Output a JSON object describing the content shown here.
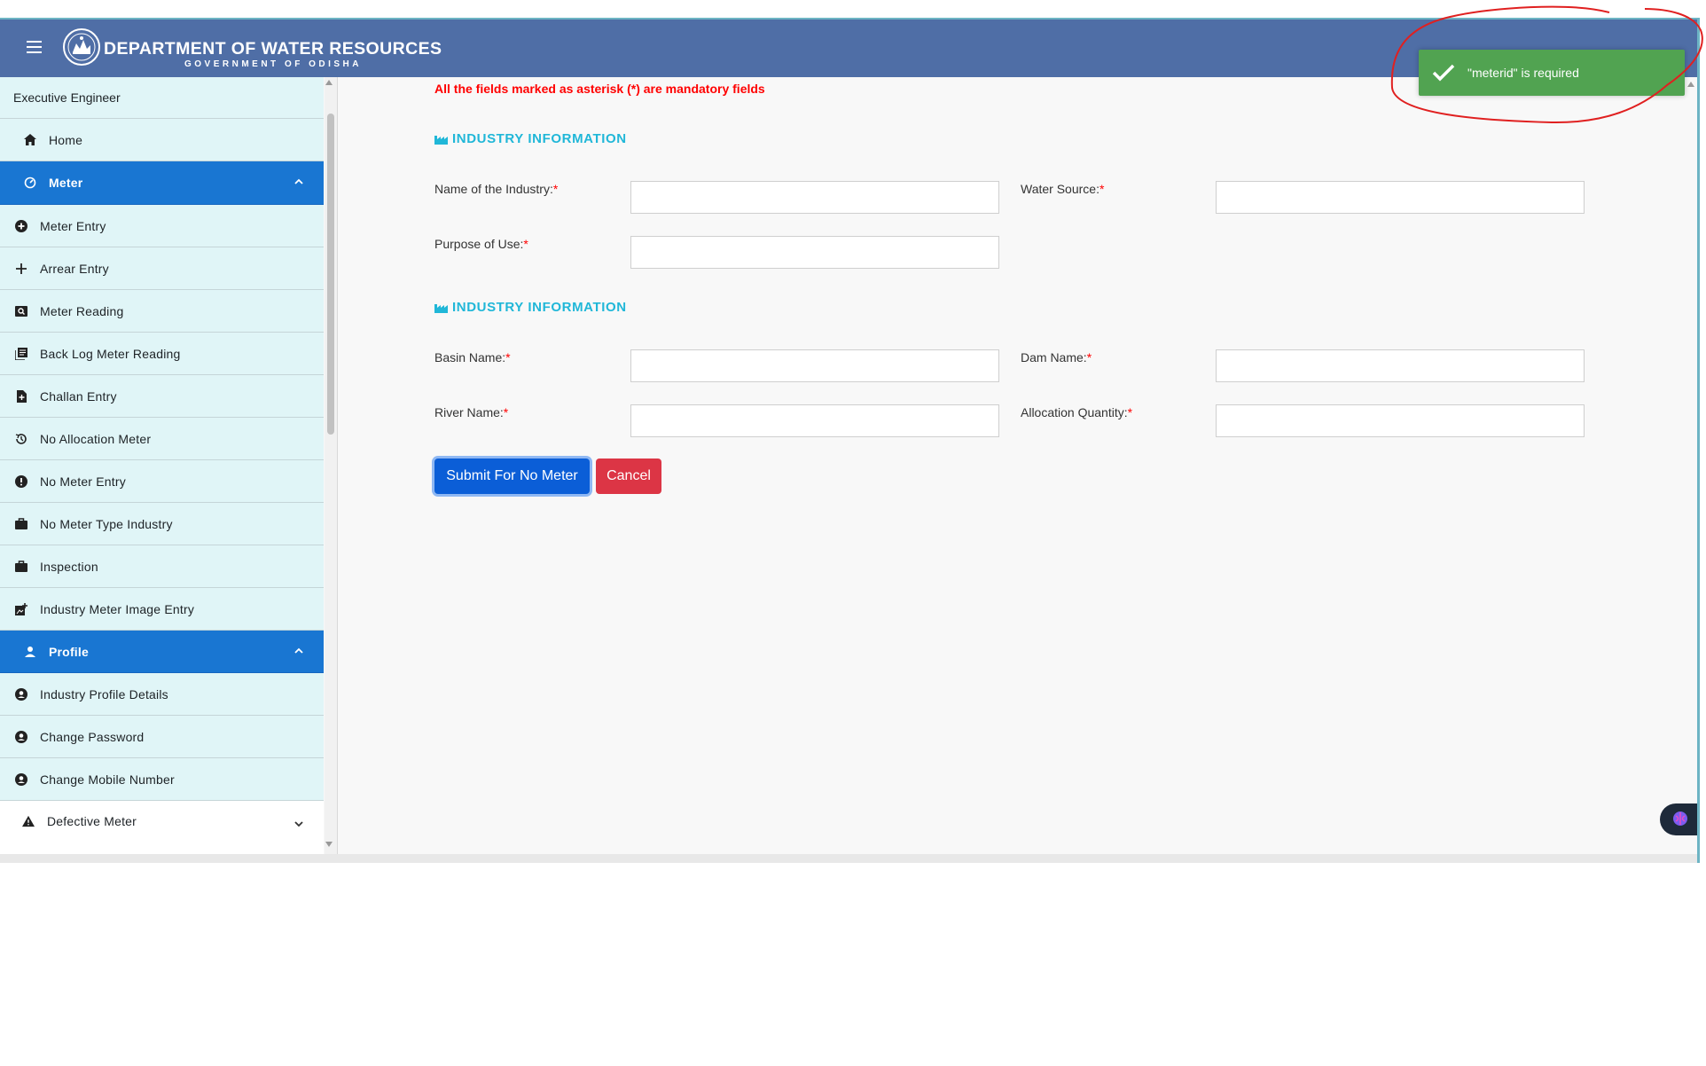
{
  "header": {
    "title": "DEPARTMENT OF WATER RESOURCES",
    "subtitle": "GOVERNMENT OF ODISHA"
  },
  "sidebar": {
    "role": "Executive Engineer",
    "home": "Home",
    "meter_group": "Meter",
    "meter_items": [
      {
        "label": "Meter Entry",
        "icon": "plus-circle-icon"
      },
      {
        "label": "Arrear Entry",
        "icon": "plus-icon"
      },
      {
        "label": "Meter Reading",
        "icon": "image-search-icon"
      },
      {
        "label": "Back Log Meter Reading",
        "icon": "library-books-icon"
      },
      {
        "label": "Challan Entry",
        "icon": "file-icon"
      },
      {
        "label": "No Allocation Meter",
        "icon": "restore-icon"
      },
      {
        "label": "No Meter Entry",
        "icon": "alert-circle-icon"
      },
      {
        "label": "No Meter Type Industry",
        "icon": "briefcase-icon"
      },
      {
        "label": "Inspection",
        "icon": "briefcase-icon"
      },
      {
        "label": "Industry Meter Image Entry",
        "icon": "add-photo-icon"
      }
    ],
    "profile_group": "Profile",
    "profile_items": [
      {
        "label": "Industry Profile Details",
        "icon": "account-circle-icon"
      },
      {
        "label": "Change Password",
        "icon": "account-circle-icon"
      },
      {
        "label": "Change Mobile Number",
        "icon": "account-circle-icon"
      }
    ],
    "defective_group": "Defective Meter"
  },
  "main": {
    "notice": "All the fields marked as asterisk (*) are mandatory fields",
    "section1_title": "INDUSTRY INFORMATION",
    "section2_title": "INDUSTRY INFORMATION",
    "fields": {
      "industry_name": {
        "label": "Name of the Industry:",
        "value": ""
      },
      "water_source": {
        "label": "Water Source:",
        "value": ""
      },
      "purpose": {
        "label": "Purpose of Use:",
        "value": ""
      },
      "basin": {
        "label": "Basin Name:",
        "value": ""
      },
      "dam": {
        "label": "Dam Name:",
        "value": ""
      },
      "river": {
        "label": "River Name:",
        "value": ""
      },
      "allocation": {
        "label": "Allocation Quantity:",
        "value": ""
      }
    },
    "required_mark": "*",
    "submit_label": "Submit For No Meter",
    "cancel_label": "Cancel"
  },
  "toast": {
    "message": "\"meterid\" is required"
  },
  "colors": {
    "header_bg": "#4f6ea6",
    "sidebar_item_bg": "#e0f5f7",
    "sidebar_active_bg": "#1976d2",
    "section_title": "#20b7d8",
    "submit_bg": "#0b5ed7",
    "cancel_bg": "#dc3545",
    "toast_bg": "#51a351",
    "notice_text": "#ff0000",
    "annotation_stroke": "#e02020"
  }
}
